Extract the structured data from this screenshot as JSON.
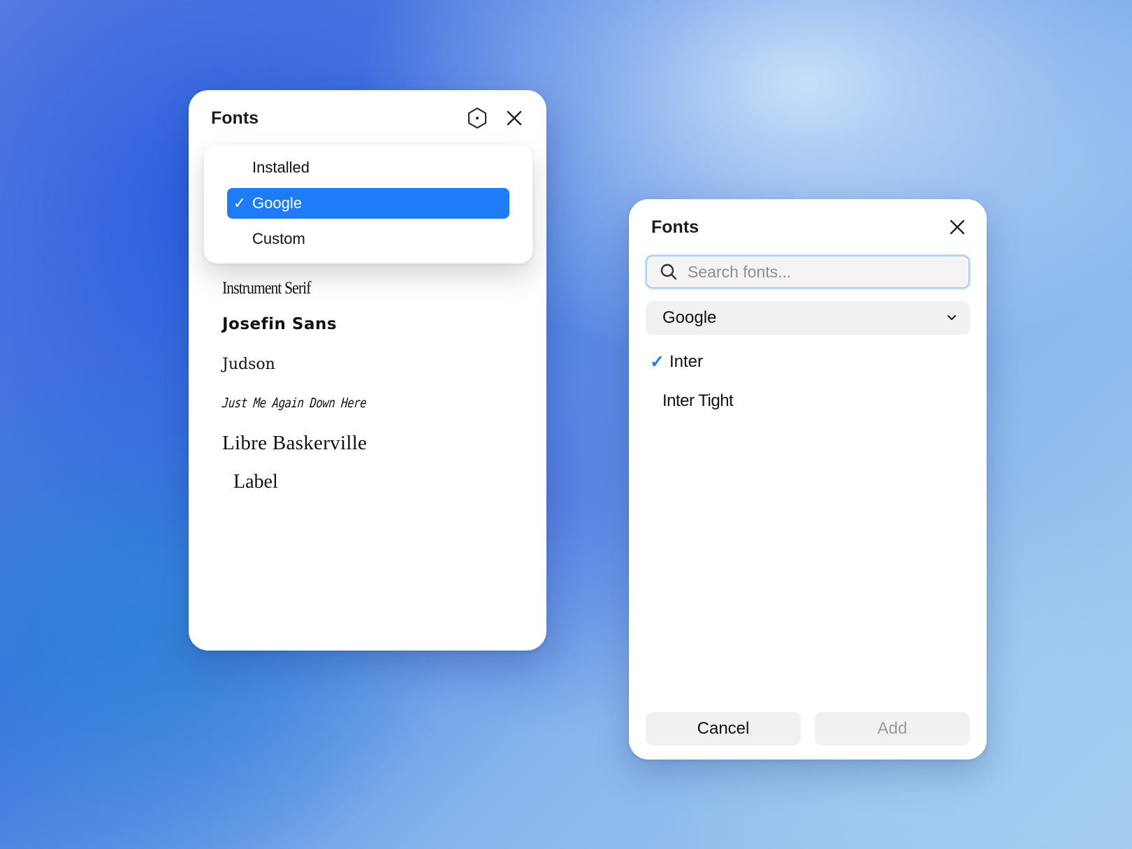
{
  "left_panel": {
    "title": "Fonts",
    "dropdown": {
      "items": [
        {
          "label": "Installed",
          "checked": false
        },
        {
          "label": "Google",
          "checked": true
        },
        {
          "label": "Custom",
          "checked": false
        }
      ],
      "check_glyph": "✓"
    },
    "fonts": [
      "Instrument Serif",
      "Josefin Sans",
      "Judson",
      "Just Me Again Down Here",
      "Libre Baskerville",
      "Label"
    ]
  },
  "right_panel": {
    "title": "Fonts",
    "search": {
      "placeholder": "Search fonts...",
      "value": ""
    },
    "source_select": {
      "value": "Google"
    },
    "results": [
      {
        "label": "Inter",
        "checked": true
      },
      {
        "label": "Inter Tight",
        "checked": false
      }
    ],
    "check_glyph": "✓",
    "cancel_label": "Cancel",
    "add_label": "Add"
  },
  "colors": {
    "accent": "#1f7cf7",
    "panel_bg": "#ffffff",
    "field_bg": "#f1f1f1",
    "disabled_text": "#9c9c9c"
  },
  "icons": [
    "hexagon-settings-icon",
    "close-icon",
    "search-icon",
    "chevron-down-icon",
    "check-icon"
  ]
}
